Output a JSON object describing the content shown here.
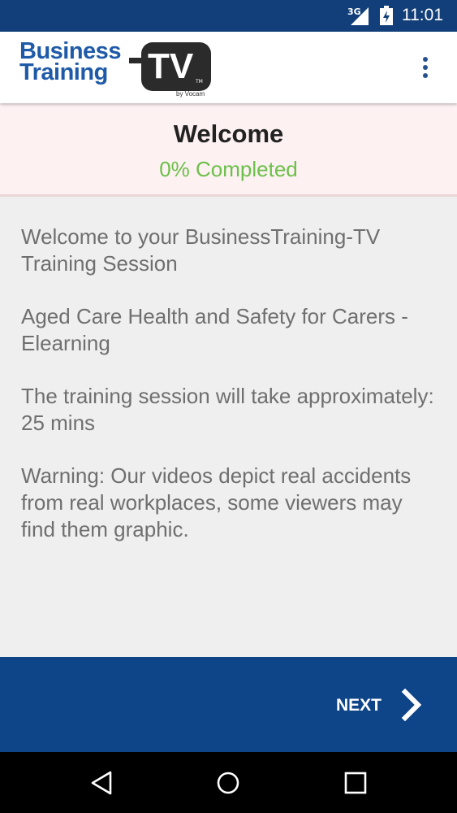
{
  "status_bar": {
    "network": "3G",
    "time": "11:01",
    "icons": [
      "signal-icon",
      "battery-icon"
    ]
  },
  "app_bar": {
    "logo": {
      "word1": "Business",
      "word2": "Training",
      "tv": "TV",
      "trademark": "TM",
      "byline": "by Vocam"
    },
    "menu_icon": "overflow-menu-icon"
  },
  "header": {
    "title": "Welcome",
    "progress_text": "0% Completed",
    "progress_percent": 0
  },
  "content": {
    "paragraphs": [
      "Welcome to your BusinessTraining-TV Training Session",
      "Aged Care Health and Safety for Carers - Elearning",
      "The training session will take approximately: 25 mins",
      "Warning: Our videos depict real accidents from real workplaces, some viewers may find them graphic."
    ]
  },
  "footer": {
    "next_label": "NEXT",
    "next_icon": "chevron-right-icon"
  },
  "nav_bar": {
    "icons": [
      "back-icon",
      "home-icon",
      "recents-icon"
    ]
  },
  "colors": {
    "status_bar": "#123f7a",
    "brand_blue": "#1e5aa8",
    "footer": "#0e4488",
    "header_bg": "#fdf1f2",
    "progress_green": "#6cc04a",
    "body_text": "#6f6f6f"
  }
}
